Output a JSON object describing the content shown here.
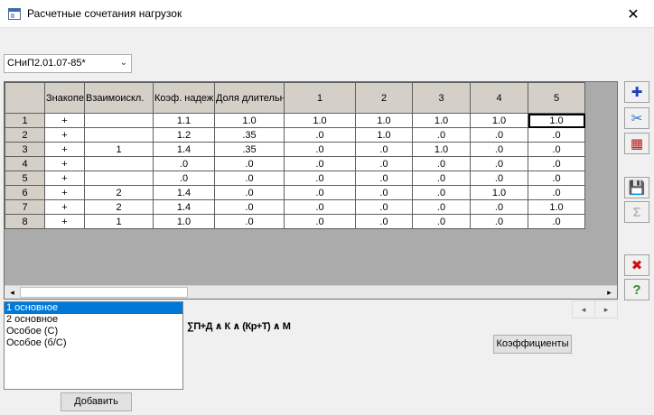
{
  "window": {
    "title": "Расчетные сочетания нагрузок",
    "close_glyph": "✕"
  },
  "norm_select": {
    "value": "СНиП2.01.07-85*"
  },
  "grid": {
    "columns": [
      "Знакоперем.",
      "Взаимоискл.",
      "Коэф. надежн.",
      "Доля длительн.",
      "1",
      "2",
      "3",
      "4",
      "5"
    ],
    "rows": [
      {
        "num": "1",
        "cells": [
          "+",
          "",
          "1.1",
          "1.0",
          "1.0",
          "1.0",
          "1.0",
          "1.0",
          "1.0"
        ]
      },
      {
        "num": "2",
        "cells": [
          "+",
          "",
          "1.2",
          ".35",
          ".0",
          "1.0",
          ".0",
          ".0",
          ".0"
        ]
      },
      {
        "num": "3",
        "cells": [
          "+",
          "1",
          "1.4",
          ".35",
          ".0",
          ".0",
          "1.0",
          ".0",
          ".0"
        ]
      },
      {
        "num": "4",
        "cells": [
          "+",
          "",
          ".0",
          ".0",
          ".0",
          ".0",
          ".0",
          ".0",
          ".0"
        ]
      },
      {
        "num": "5",
        "cells": [
          "+",
          "",
          ".0",
          ".0",
          ".0",
          ".0",
          ".0",
          ".0",
          ".0"
        ]
      },
      {
        "num": "6",
        "cells": [
          "+",
          "2",
          "1.4",
          ".0",
          ".0",
          ".0",
          ".0",
          "1.0",
          ".0"
        ]
      },
      {
        "num": "7",
        "cells": [
          "+",
          "2",
          "1.4",
          ".0",
          ".0",
          ".0",
          ".0",
          ".0",
          "1.0"
        ]
      },
      {
        "num": "8",
        "cells": [
          "+",
          "1",
          "1.0",
          ".0",
          ".0",
          ".0",
          ".0",
          ".0",
          ".0"
        ]
      }
    ],
    "selected": {
      "row": 1,
      "col": "5"
    }
  },
  "toolbar": [
    {
      "name": "add-icon",
      "glyph": "✚",
      "color": "#1f3fbf"
    },
    {
      "name": "cut-icon",
      "glyph": "✂",
      "color": "#1c6fc4"
    },
    {
      "name": "delete-rows-icon",
      "glyph": "▦",
      "color": "#c01616"
    },
    {
      "name": "save-icon",
      "glyph": "💾",
      "color": "#1a1a4a"
    },
    {
      "name": "sum-icon",
      "glyph": "Σ",
      "color": "#b8b8b8"
    },
    {
      "name": "close-x-icon",
      "glyph": "✖",
      "color": "#d01010"
    },
    {
      "name": "help-icon",
      "glyph": "?",
      "color": "#2e8b2e"
    }
  ],
  "combo_types": [
    "1 основное",
    "2 основное",
    "Особое (С)",
    "Особое (б/С)"
  ],
  "formula": "∑П+Д ∧ К ∧ (Кр+Т) ∧ М",
  "buttons": {
    "coefficients": "Коэффициенты",
    "add": "Добавить"
  },
  "pager": {
    "prev": "◂",
    "next": "▸"
  },
  "scroll": {
    "left": "◂",
    "right": "▸"
  }
}
